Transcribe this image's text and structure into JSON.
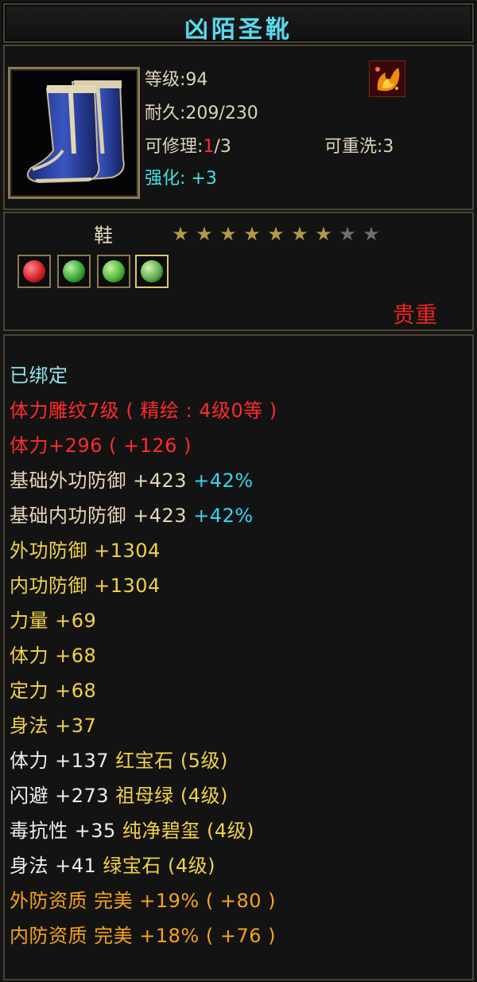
{
  "item": {
    "name": "凶陌圣靴",
    "level_label": "等级:94",
    "durability_label": "耐久:209/230",
    "repair_prefix": "可修理:",
    "repair_current": "1",
    "repair_suffix": "/3",
    "rewash_label": "可重洗:3",
    "enhance_label": "强化: +3",
    "slot_label": "鞋",
    "stars_total": 9,
    "stars_filled": 7,
    "rarity": "贵重",
    "icons": {
      "item": "blue-boots-icon",
      "emblem": "flame-emblem-icon"
    },
    "gems": [
      {
        "name": "red-gem-icon",
        "color": "#d4202a"
      },
      {
        "name": "green-gem-icon",
        "color": "#3aa83a"
      },
      {
        "name": "green-gem-icon",
        "color": "#4fb83a"
      },
      {
        "name": "green-gem-icon",
        "color": "#5cb04a"
      }
    ]
  },
  "stats": {
    "bound": "已绑定",
    "engrave": "体力雕纹7级 ( 精绘 : 4级0等 )",
    "stamina_bonus": "体力+296 ( +126 )",
    "base_outer_def": "基础外功防御 +423",
    "base_outer_def_pct": "+42%",
    "base_inner_def": "基础内功防御 +423",
    "base_inner_def_pct": "+42%",
    "outer_def": "外功防御 +1304",
    "inner_def": "内功防御 +1304",
    "strength": "力量 +69",
    "stamina": "体力 +68",
    "focus": "定力 +68",
    "agility": "身法 +37",
    "gem1_stat": "体力 +137",
    "gem1_name": "红宝石 (5级)",
    "gem2_stat": "闪避 +273",
    "gem2_name": "祖母绿 (4级)",
    "gem3_stat": "毒抗性 +35",
    "gem3_name": "纯净碧玺 (4级)",
    "gem4_stat": "身法 +41",
    "gem4_name": "绿宝石 (4级)",
    "outer_quality": "外防资质  完美 +19% ( +80 )",
    "inner_quality": "内防资质  完美 +18% ( +76 )"
  },
  "colors": {
    "title": "#5fd7e8",
    "red": "#ff2b2b",
    "cyan": "#33d6ee",
    "yellow": "#f0d24a",
    "orange": "#f5a31a",
    "base": "#e6d6b6"
  }
}
